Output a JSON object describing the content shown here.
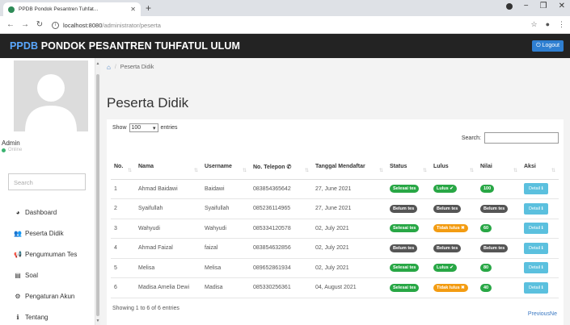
{
  "browser": {
    "tab_title": "PPDB Pondok Pesantren Tuhfat...",
    "url_host": "localhost:8080",
    "url_path": "/administrator/peserta"
  },
  "app": {
    "brand": "PPDB",
    "brand_rest": " PONDOK PESANTREN TUHFATUL ULUM",
    "logout_label": "Logout"
  },
  "sidebar": {
    "user_name": "Admin",
    "user_status": "Online",
    "search_placeholder": "Search",
    "items": [
      {
        "label": "Dashboard",
        "icon": "dashboard-icon"
      },
      {
        "label": "Peserta Didik",
        "icon": "users-icon"
      },
      {
        "label": "Pengumuman Tes",
        "icon": "announcement-icon"
      },
      {
        "label": "Soal",
        "icon": "list-icon"
      },
      {
        "label": "Pengaturan Akun",
        "icon": "gears-icon"
      },
      {
        "label": "Tentang",
        "icon": "info-icon"
      }
    ]
  },
  "main": {
    "breadcrumb_current": "Peserta Didik",
    "page_title": "Peserta Didik",
    "show_label": "Show",
    "show_value": "100",
    "entries_label": "entries",
    "search_label": "Search:",
    "columns": [
      "No.",
      "Nama",
      "Username",
      "No. Telepon",
      "Tanggal Mendaftar",
      "Status",
      "Lulus",
      "Nilai",
      "Aksi"
    ],
    "rows": [
      {
        "no": "1",
        "nama": "Ahmad Baidawi",
        "username": "Baidawi",
        "telepon": "083854365642",
        "tanggal": "27, June 2021",
        "status": "Selesai tes",
        "lulus": "Lulus ✔",
        "nilai": "100",
        "aksi": "Detail"
      },
      {
        "no": "2",
        "nama": "Syaifullah",
        "username": "Syaifullah",
        "telepon": "085236114965",
        "tanggal": "27, June 2021",
        "status": "Belum tes",
        "lulus": "Belum tes",
        "nilai": "Belum tes",
        "aksi": "Detail"
      },
      {
        "no": "3",
        "nama": "Wahyudi",
        "username": "Wahyudi",
        "telepon": "085334120578",
        "tanggal": "02, July 2021",
        "status": "Selesai tes",
        "lulus": "Tidak lulus ✖",
        "nilai": "60",
        "aksi": "Detail"
      },
      {
        "no": "4",
        "nama": "Ahmad Faizal",
        "username": "faizal",
        "telepon": "083854632856",
        "tanggal": "02, July 2021",
        "status": "Belum tes",
        "lulus": "Belum tes",
        "nilai": "Belum tes",
        "aksi": "Detail"
      },
      {
        "no": "5",
        "nama": "Melisa",
        "username": "Melisa",
        "telepon": "089652861934",
        "tanggal": "02, July 2021",
        "status": "Selesai tes",
        "lulus": "Lulus ✔",
        "nilai": "80",
        "aksi": "Detail"
      },
      {
        "no": "6",
        "nama": "Madisa Amelia Dewi",
        "username": "Madisa",
        "telepon": "085330256361",
        "tanggal": "04, August 2021",
        "status": "Selesai tes",
        "lulus": "Tidak lulus ✖",
        "nilai": "40",
        "aksi": "Detail"
      }
    ],
    "info": "Showing 1 to 6 of 6 entries",
    "pager": "PreviousNe"
  },
  "colors": {
    "header_bg": "#232323",
    "badge_green": "#28a745",
    "badge_dark": "#555555",
    "badge_orange": "#f39c12",
    "detail_btn": "#5bc0de"
  }
}
